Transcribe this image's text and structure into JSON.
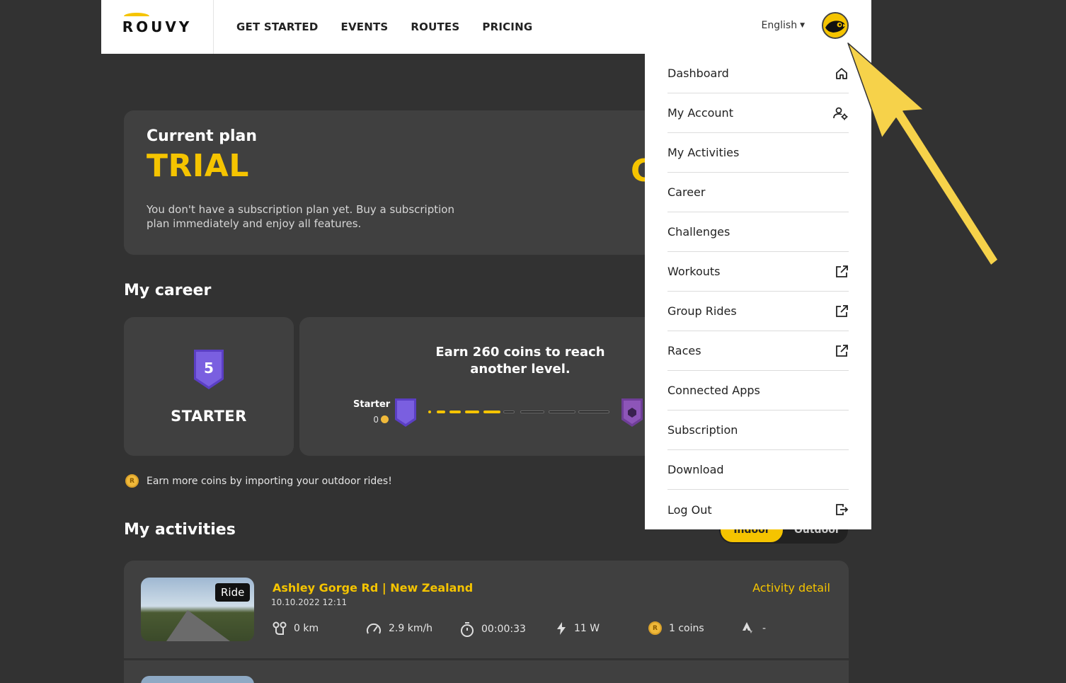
{
  "header": {
    "logo": "ROUVY",
    "nav": [
      "GET STARTED",
      "EVENTS",
      "ROUTES",
      "PRICING"
    ],
    "language": "English"
  },
  "plan": {
    "label": "Current plan",
    "name": "TRIAL",
    "description": "You don't have a subscription plan yet. Buy a subscription plan immediately and enjoy all features.",
    "peek_char": "C"
  },
  "career": {
    "title": "My career",
    "level_number": "5",
    "level_name": "STARTER",
    "earn_text": "Earn 260 coins to reach another level.",
    "current_label": "Starter",
    "current_coins": "0",
    "progress_fraction": 0.4,
    "coin_hint": "Earn more coins by importing your outdoor rides!"
  },
  "activities": {
    "title": "My activities",
    "toggle": {
      "indoor": "Indoor",
      "outdoor": "Outdoor"
    },
    "items": [
      {
        "tag": "Ride",
        "title": "Ashley Gorge Rd | New Zealand",
        "date": "10.10.2022 12:11",
        "detail_link": "Activity detail",
        "distance": "0 km",
        "speed": "2.9 km/h",
        "duration": "00:00:33",
        "power": "11 W",
        "coins": "1 coins",
        "strava": "-"
      }
    ]
  },
  "dropdown": {
    "items": [
      {
        "label": "Dashboard",
        "icon": "home-icon"
      },
      {
        "label": "My Account",
        "icon": "user-settings-icon"
      },
      {
        "label": "My Activities",
        "icon": ""
      },
      {
        "label": "Career",
        "icon": ""
      },
      {
        "label": "Challenges",
        "icon": ""
      },
      {
        "label": "Workouts",
        "icon": "external-link-icon"
      },
      {
        "label": "Group Rides",
        "icon": "external-link-icon"
      },
      {
        "label": "Races",
        "icon": "external-link-icon"
      },
      {
        "label": "Connected Apps",
        "icon": ""
      },
      {
        "label": "Subscription",
        "icon": ""
      },
      {
        "label": "Download",
        "icon": ""
      },
      {
        "label": "Log Out",
        "icon": "logout-icon"
      }
    ]
  },
  "colors": {
    "accent": "#f5c400",
    "background": "#323232",
    "card": "#404040",
    "badge": "#6b4fd0",
    "arrow": "#f6d24a"
  }
}
